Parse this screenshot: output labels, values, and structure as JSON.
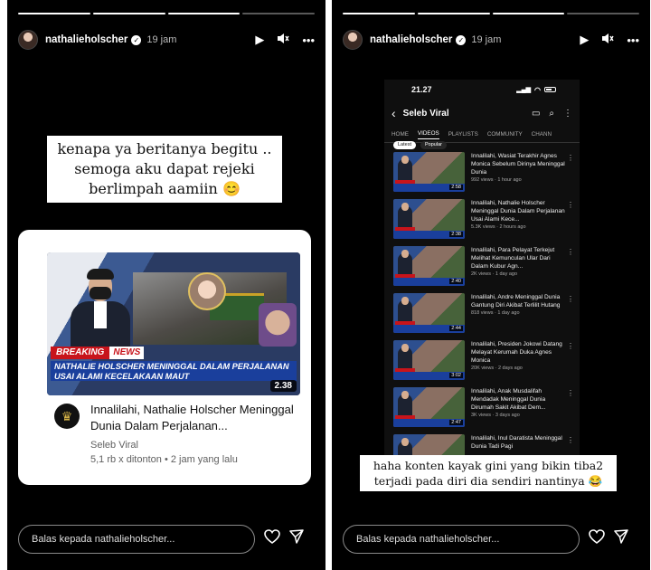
{
  "left_story": {
    "username": "nathalieholscher",
    "time": "19 jam",
    "caption": "kenapa ya beritanya begitu .. semoga aku dapat rejeki berlimpah aamiin 😊",
    "card": {
      "breaking": "BREAKING",
      "news": "NEWS",
      "banner": "NATHALIE HOLSCHER MENINGGAL DALAM PERJALANAN USAI ALAMI KECELAKAAN MAUT",
      "duration": "2.38",
      "title": "Innalilahi, Nathalie Holscher Meninggal Dunia Dalam Perjalanan...",
      "channel": "Seleb Viral",
      "stats": "5,1 rb x ditonton • 2 jam yang lalu"
    },
    "reply_placeholder": "Balas kepada nathalieholscher..."
  },
  "right_story": {
    "username": "nathalieholscher",
    "time": "19 jam",
    "phone": {
      "clock": "21.27",
      "channel_name": "Seleb Viral",
      "tabs": [
        "HOME",
        "VIDEOS",
        "PLAYLISTS",
        "COMMUNITY",
        "CHANN"
      ],
      "active_tab": "VIDEOS",
      "chips": [
        "Latest",
        "Popular"
      ],
      "videos": [
        {
          "title": "Innalilahi, Wasiat Terakhir Agnes Monica Sebelum Dirinya Meninggal Dunia",
          "meta": "992 views · 1 hour ago",
          "duration": "2:58"
        },
        {
          "title": "Innalilahi, Nathalie Holscher Meninggal Dunia Dalam Perjalanan Usai Alami Kece...",
          "meta": "5.3K views · 2 hours ago",
          "duration": "2:38"
        },
        {
          "title": "Innalilahi, Para Pelayat Terkejut Melihat Kemunculan Ular Dari Dalam Kubur Agn...",
          "meta": "2K views · 1 day ago",
          "duration": "2:40"
        },
        {
          "title": "Innalilahi, Andre Meninggal Dunia Gantung Diri Akibat Terlilit Hutang",
          "meta": "818 views · 1 day ago",
          "duration": "2:44"
        },
        {
          "title": "Innalilahi, Presiden Jokowi Datang Melayat Kerumah Duka Agnes Monica",
          "meta": "20K views · 2 days ago",
          "duration": "3:02"
        },
        {
          "title": "Innalilahi, Anak Musdalifah Mendadak Meninggal Dunia Dirumah Sakit Akibat Dem...",
          "meta": "3K views · 3 days ago",
          "duration": "2:47"
        },
        {
          "title": "Innalilahi, Inul Daratista Meninggal Dunia Tadi Pagi",
          "meta": "",
          "duration": ""
        }
      ]
    },
    "caption": "haha konten kayak gini yang bikin tiba2 terjadi pada diri dia sendiri nantinya 😂",
    "reply_placeholder": "Balas kepada nathalieholscher..."
  },
  "icons": {
    "verified": "verified-badge-icon",
    "play": "play-icon",
    "mute": "mute-icon",
    "more": "more-icon",
    "heart": "heart-icon",
    "send": "send-icon"
  }
}
